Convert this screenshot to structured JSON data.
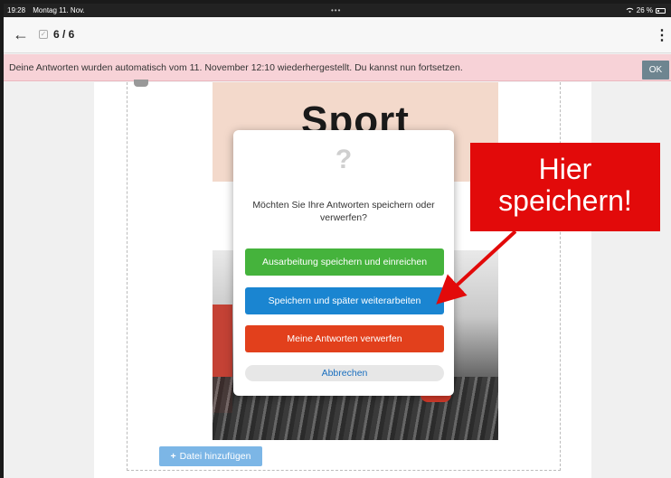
{
  "status_bar": {
    "time": "19:28",
    "date": "Montag 11. Nov.",
    "dots": "•••",
    "battery": "26 %"
  },
  "topbar": {
    "counter": "6 / 6"
  },
  "banner": {
    "message": "Deine Antworten wurden automatisch vom 11. November 12:10 wiederhergestellt. Du kannst nun fortsetzen.",
    "ok_label": "OK"
  },
  "content": {
    "sport_title": "Sport",
    "add_file_label": "Datei hinzufügen"
  },
  "modal": {
    "icon": "?",
    "message": "Möchten Sie Ihre Antworten speichern oder verwerfen?",
    "buttons": {
      "submit": "Ausarbeitung speichern und einreichen",
      "save_later": "Speichern und später weiterarbeiten",
      "discard": "Meine Antworten verwerfen",
      "cancel": "Abbrechen"
    }
  },
  "callout": {
    "text": "Hier speichern!"
  },
  "colors": {
    "green": "#45b33c",
    "blue": "#1a85d1",
    "orange": "#e2401c",
    "callout_red": "#e20a0a",
    "banner_pink": "#f7d2d7"
  }
}
